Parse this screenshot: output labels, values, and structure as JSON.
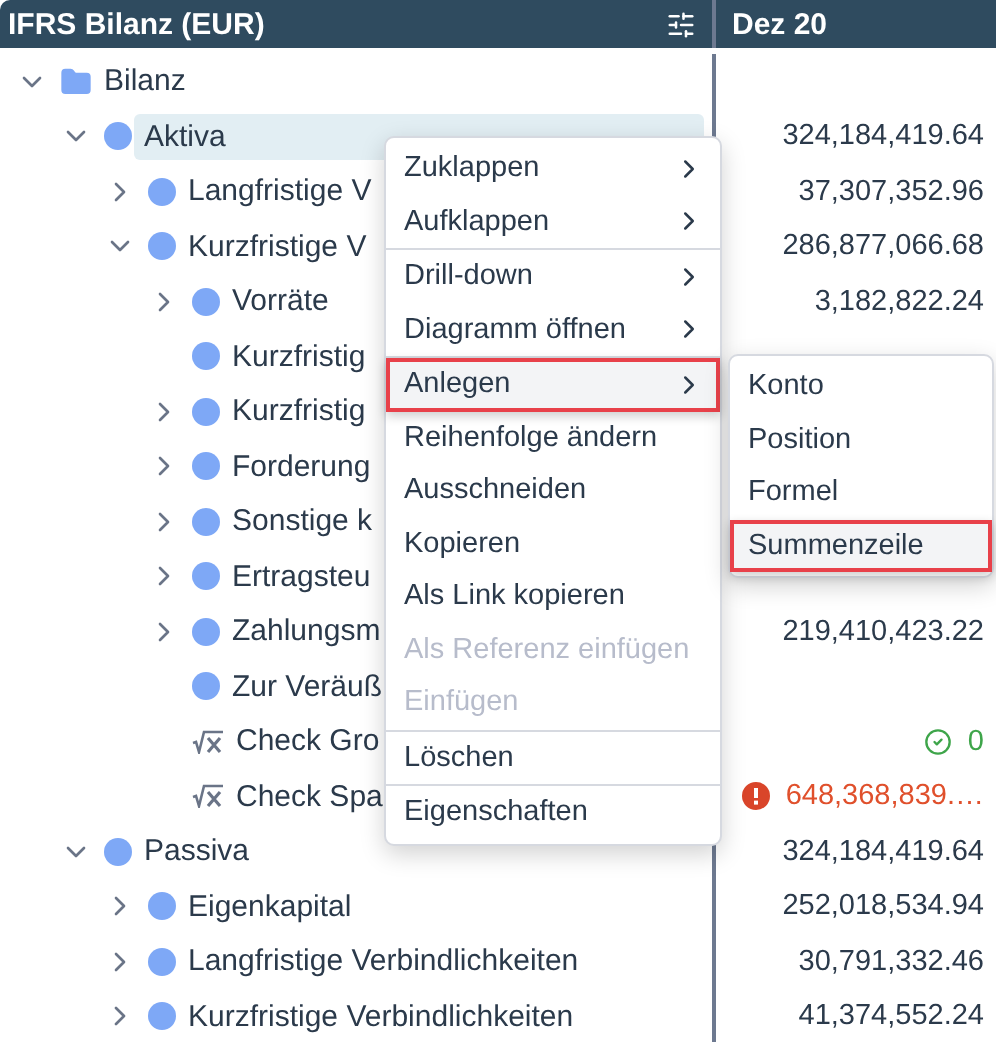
{
  "header": {
    "title": "IFRS Bilanz (EUR)",
    "column": "Dez 20"
  },
  "tree": [
    {
      "label": "Bilanz",
      "kind": "folder",
      "expanded": true,
      "selected": false,
      "children": [
        {
          "label": "Aktiva",
          "kind": "item",
          "expanded": true,
          "selected": true,
          "value": "324,184,419.64",
          "children": [
            {
              "label": "Langfristige V",
              "kind": "item",
              "expanded": false,
              "selected": false,
              "value": "37,307,352.96"
            },
            {
              "label": "Kurzfristige V",
              "kind": "item",
              "expanded": true,
              "selected": false,
              "value": "286,877,066.68",
              "children": [
                {
                  "label": "Vorräte",
                  "kind": "item",
                  "expanded": false,
                  "selected": false,
                  "value": "3,182,822.24"
                },
                {
                  "label": "Kurzfristig",
                  "kind": "item",
                  "selected": false
                },
                {
                  "label": "Kurzfristig",
                  "kind": "item",
                  "expanded": false,
                  "selected": false
                },
                {
                  "label": "Forderung",
                  "kind": "item",
                  "expanded": false,
                  "selected": false
                },
                {
                  "label": "Sonstige k",
                  "kind": "item",
                  "expanded": false,
                  "selected": false
                },
                {
                  "label": "Ertragsteu",
                  "kind": "item",
                  "expanded": false,
                  "selected": false
                },
                {
                  "label": "Zahlungsm",
                  "kind": "item",
                  "expanded": false,
                  "selected": false,
                  "value": "219,410,423.22"
                },
                {
                  "label": "Zur Veräuß",
                  "kind": "item",
                  "selected": false
                },
                {
                  "label": "Check Gro",
                  "kind": "formula",
                  "selected": false,
                  "value": "0",
                  "error": false
                },
                {
                  "label": "Check Spa",
                  "kind": "formula",
                  "selected": false,
                  "value": "648,368,839.…",
                  "error": true
                }
              ]
            }
          ]
        },
        {
          "label": "Passiva",
          "kind": "item",
          "expanded": true,
          "selected": false,
          "value": "324,184,419.64",
          "children": [
            {
              "label": "Eigenkapital",
              "kind": "item",
              "expanded": false,
              "selected": false,
              "value": "252,018,534.94"
            },
            {
              "label": "Langfristige Verbindlichkeiten",
              "kind": "item",
              "expanded": false,
              "selected": false,
              "value": "30,791,332.46"
            },
            {
              "label": "Kurzfristige Verbindlichkeiten",
              "kind": "item",
              "expanded": false,
              "selected": false,
              "value": "41,374,552.24"
            }
          ]
        }
      ]
    }
  ],
  "menu": [
    {
      "label": "Zuklappen",
      "submenu": true,
      "disabled": false,
      "selected": false
    },
    {
      "label": "Aufklappen",
      "submenu": true,
      "disabled": false,
      "selected": false,
      "divider": true
    },
    {
      "label": "Drill-down",
      "submenu": true,
      "disabled": false,
      "selected": false
    },
    {
      "label": "Diagramm öffnen",
      "submenu": true,
      "disabled": false,
      "selected": false,
      "divider": true
    },
    {
      "label": "Anlegen",
      "submenu": true,
      "disabled": false,
      "selected": true
    },
    {
      "label": "Reihenfolge ändern",
      "submenu": false,
      "disabled": false,
      "selected": false
    },
    {
      "label": "Ausschneiden",
      "submenu": false,
      "disabled": false,
      "selected": false
    },
    {
      "label": "Kopieren",
      "submenu": false,
      "disabled": false,
      "selected": false
    },
    {
      "label": "Als Link kopieren",
      "submenu": false,
      "disabled": false,
      "selected": false
    },
    {
      "label": "Als Referenz einfügen",
      "submenu": false,
      "disabled": true,
      "selected": false
    },
    {
      "label": "Einfügen",
      "submenu": false,
      "disabled": true,
      "selected": false,
      "divider": true
    },
    {
      "label": "Löschen",
      "submenu": false,
      "disabled": false,
      "selected": false,
      "divider": true
    },
    {
      "label": "Eigenschaften",
      "submenu": false,
      "disabled": false,
      "selected": false
    }
  ],
  "submenu": [
    {
      "label": "Konto",
      "selected": false
    },
    {
      "label": "Position",
      "selected": false
    },
    {
      "label": "Formel",
      "selected": false
    },
    {
      "label": "Summenzeile",
      "selected": true
    }
  ]
}
